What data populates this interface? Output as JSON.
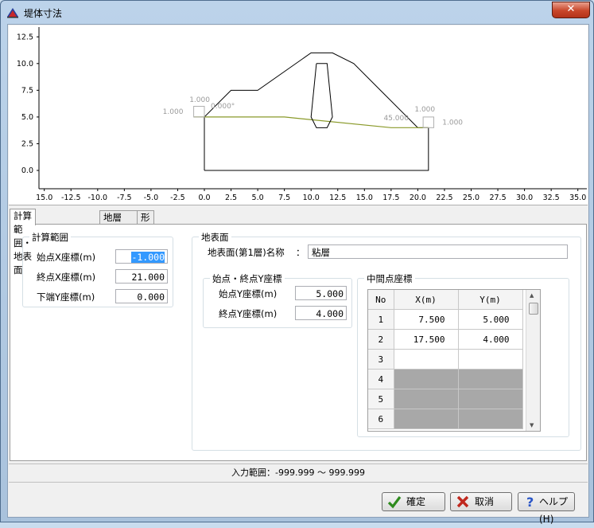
{
  "window": {
    "title": "堤体寸法",
    "close_label": "✕"
  },
  "chart": {
    "y_ticks": [
      "12.5",
      "10.0",
      "7.5",
      "5.0",
      "2.5",
      "0.0"
    ],
    "x_ticks": [
      "15.0",
      "-12.5",
      "-10.0",
      "-7.5",
      "-5.0",
      "-2.5",
      "0.0",
      "2.5",
      "5.0",
      "7.5",
      "10.0",
      "12.5",
      "15.0",
      "17.5",
      "20.0",
      "22.5",
      "25.0",
      "27.5",
      "30.0",
      "32.5",
      "35.0"
    ],
    "annotations": {
      "left_top": "1.000",
      "left_side": "1.000",
      "left_angle": "0.000°",
      "right_top": "1.000",
      "right_angle": "45.000",
      "right_side": "1.000"
    }
  },
  "chart_data": {
    "type": "line",
    "xlim": [
      -15,
      35
    ],
    "ylim": [
      -1,
      13
    ],
    "series": [
      {
        "values": [
          [
            0,
            0
          ],
          [
            21,
            0
          ],
          [
            21,
            4
          ],
          [
            20,
            4
          ],
          [
            19,
            5
          ],
          [
            16.5,
            7.5
          ],
          [
            14,
            10
          ],
          [
            12,
            11
          ],
          [
            10,
            11
          ],
          [
            5,
            7.5
          ],
          [
            2.5,
            7.5
          ],
          [
            0,
            5
          ],
          [
            0,
            0
          ]
        ]
      },
      {
        "values": [
          [
            -1,
            5
          ],
          [
            7.5,
            5
          ],
          [
            17.5,
            4
          ],
          [
            21,
            4
          ]
        ]
      },
      {
        "values": [
          [
            10.5,
            10
          ],
          [
            11.5,
            10
          ],
          [
            12,
            5
          ],
          [
            11.5,
            4
          ],
          [
            10.5,
            4
          ],
          [
            10,
            5
          ],
          [
            10.5,
            10
          ]
        ]
      }
    ],
    "grid": false
  },
  "tabs": [
    "計算範囲・地表面",
    "地層",
    "形状寸法"
  ],
  "calc_range": {
    "caption": "計算範囲",
    "start_x": {
      "label": "始点X座標(m)",
      "value": "-1.000"
    },
    "end_x": {
      "label": "終点X座標(m)",
      "value": "21.000"
    },
    "bottom_y": {
      "label": "下端Y座標(m)",
      "value": "0.000"
    }
  },
  "ground_surface": {
    "caption": "地表面",
    "name_label": "地表面(第1層)名称",
    "name_sep": "：",
    "name_value": "粘層",
    "endpoints": {
      "caption": "始点・終点Y座標",
      "start_y": {
        "label": "始点Y座標(m)",
        "value": "5.000"
      },
      "end_y": {
        "label": "終点Y座標(m)",
        "value": "4.000"
      }
    },
    "midpoints": {
      "caption": "中間点座標",
      "headers": [
        "No",
        "X(m)",
        "Y(m)"
      ],
      "rows": [
        {
          "no": "1",
          "x": "7.500",
          "y": "5.000"
        },
        {
          "no": "2",
          "x": "17.500",
          "y": "4.000"
        },
        {
          "no": "3",
          "x": "",
          "y": ""
        },
        {
          "no": "4",
          "x": "",
          "y": ""
        },
        {
          "no": "5",
          "x": "",
          "y": ""
        },
        {
          "no": "6",
          "x": "",
          "y": ""
        }
      ]
    }
  },
  "status": {
    "text": "入力範囲：-999.999 ～ 999.999"
  },
  "buttons": {
    "ok": "確定",
    "cancel": "取消",
    "help": "ヘルプ(H)"
  },
  "colors": {
    "ground_line": "#8a9a2a",
    "disabled_cell": "#a8a8a8",
    "selection": "#3399ff"
  }
}
